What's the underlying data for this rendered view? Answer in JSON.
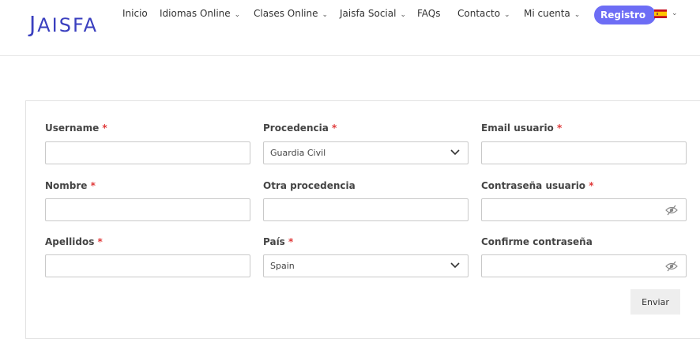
{
  "header": {
    "logo_first": "J",
    "logo_rest": "AISFA",
    "nav": [
      {
        "label": "Inicio",
        "has_dropdown": false
      },
      {
        "label": "Idiomas Online",
        "has_dropdown": true
      },
      {
        "label": "Clases Online",
        "has_dropdown": true
      },
      {
        "label": "Jaisfa Social",
        "has_dropdown": true
      },
      {
        "label": "FAQs",
        "has_dropdown": false
      },
      {
        "label": "Contacto",
        "has_dropdown": true
      },
      {
        "label": "Mi cuenta",
        "has_dropdown": true
      }
    ],
    "registro_label": "Registro",
    "language_flag": "spain-flag-icon",
    "accent_color": "#6d6df5"
  },
  "form": {
    "required_marker": "*",
    "fields": {
      "username": {
        "label": "Username",
        "required": true,
        "value": ""
      },
      "procedencia": {
        "label": "Procedencia",
        "required": true,
        "value": "Guardia Civil"
      },
      "email": {
        "label": "Email usuario",
        "required": true,
        "value": ""
      },
      "nombre": {
        "label": "Nombre",
        "required": true,
        "value": ""
      },
      "otra_procedencia": {
        "label": "Otra procedencia",
        "required": false,
        "value": ""
      },
      "contrasena": {
        "label": "Contraseña usuario",
        "required": true,
        "value": ""
      },
      "apellidos": {
        "label": "Apellidos",
        "required": true,
        "value": ""
      },
      "pais": {
        "label": "País",
        "required": true,
        "value": "Spain"
      },
      "confirme": {
        "label": "Confirme contraseña",
        "required": false,
        "value": ""
      }
    },
    "submit_label": "Enviar"
  }
}
